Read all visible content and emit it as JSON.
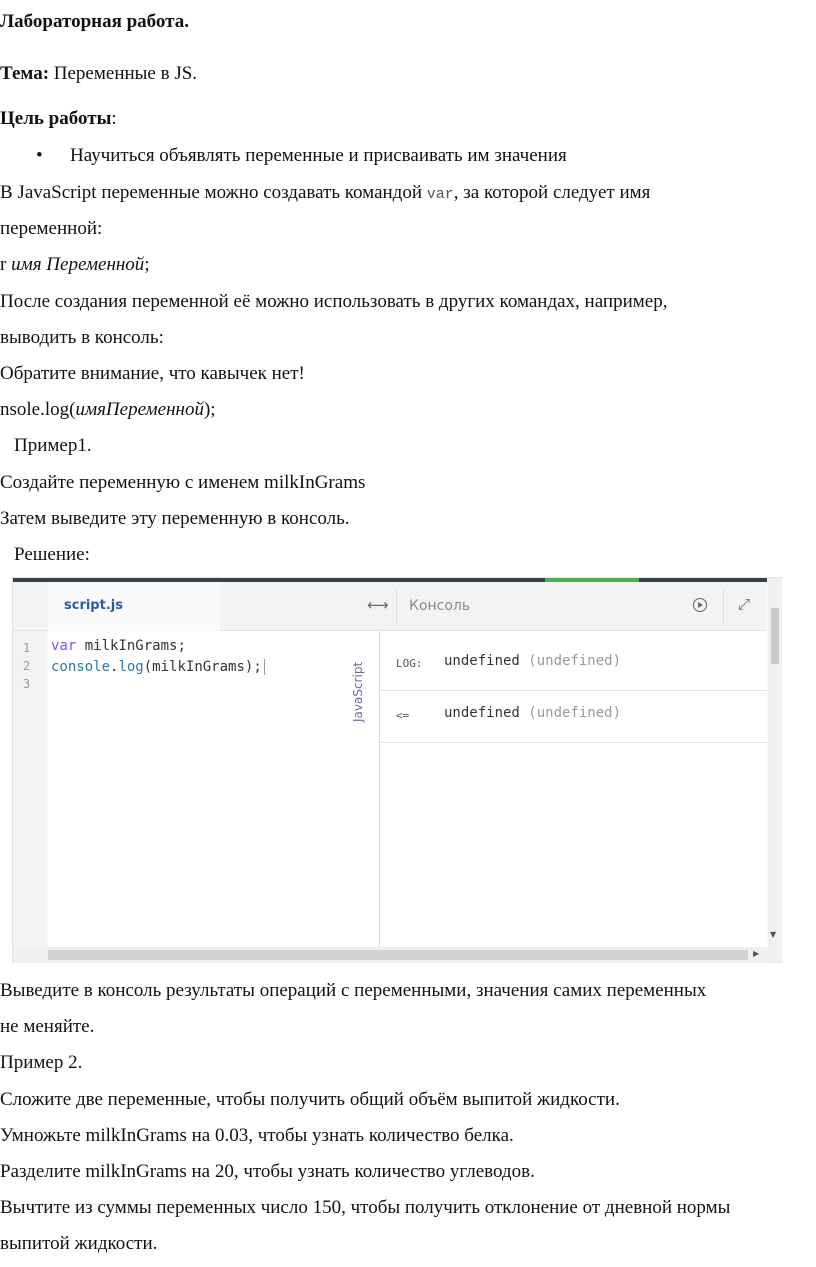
{
  "title": "Лабораторная работа.",
  "topic": {
    "label": "Тема:",
    "value": " Переменные в JS."
  },
  "goal": {
    "label": "Цель работы",
    "suffix": ":"
  },
  "bullet": "Научиться объявлять  переменные и присваивать им значения",
  "para1": {
    "before": "В JavaScript переменные можно создавать командой ",
    "code": "var",
    "after": ", за которой следует имя"
  },
  "para1_cont": "переменной:",
  "syntax": {
    "prefix": "r ",
    "name": "имя Переменной",
    "suffix": ";"
  },
  "para2": "После создания переменной её можно использовать в других командах, например,",
  "para2_cont": "выводить в консоль:",
  "note": "Обратите внимание, что кавычек нет!",
  "console_syntax": {
    "prefix": "nsole.log(",
    "name": "имяПеременной",
    "suffix": ");"
  },
  "example1": "Пример1.",
  "task1": "Создайте переменную с именем milkInGrams",
  "task2": "Затем выведите эту переменную в консоль.",
  "solution": "Решение:",
  "editor": {
    "tab_script": "script.js",
    "tab_console": "Консоль",
    "language": "JavaScript",
    "line_numbers": [
      "1",
      "2",
      "3"
    ],
    "code": {
      "l1_kw": "var",
      "l1_rest": " milkInGrams;",
      "l2_obj": "console",
      "l2_dot": ".",
      "l2_fn": "log",
      "l2_rest": "(milkInGrams);"
    },
    "console_rows": [
      {
        "label": "LOG:",
        "value": "undefined",
        "type": "(undefined)"
      },
      {
        "label": "<=",
        "value": "undefined",
        "type": "(undefined)"
      }
    ]
  },
  "after1": "Выведите в консоль результаты операций с переменными, значения самих переменных",
  "after1_cont": "не меняйте.",
  "example2": "Пример 2.",
  "step1": "Сложите две переменные, чтобы получить общий объём выпитой жидкости.",
  "step2": "Умножьте milkInGrams на 0.03, чтобы узнать количество белка.",
  "step3": "Разделите milkInGrams на 20, чтобы узнать количество углеводов.",
  "step4": "Вычтите из суммы переменных число 150, чтобы получить отклонение от дневной нормы",
  "step4_cont": "выпитой жидкости."
}
